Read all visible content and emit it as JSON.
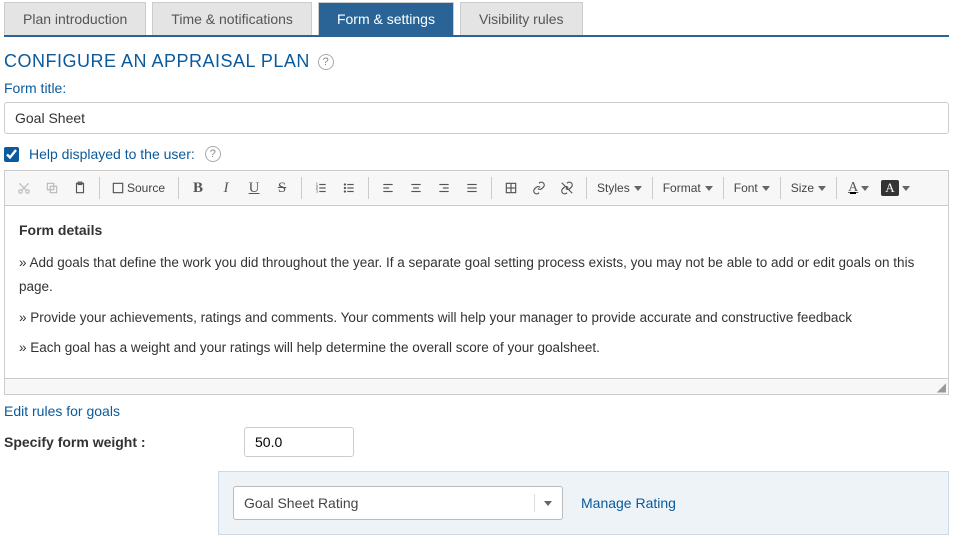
{
  "tabs": [
    {
      "label": "Plan introduction",
      "active": false
    },
    {
      "label": "Time & notifications",
      "active": false
    },
    {
      "label": "Form & settings",
      "active": true
    },
    {
      "label": "Visibility rules",
      "active": false
    }
  ],
  "page_title": "CONFIGURE AN APPRAISAL PLAN",
  "form_title_label": "Form title:",
  "form_title_value": "Goal Sheet",
  "help_checkbox_label": "Help displayed to the user:",
  "help_checked": true,
  "toolbar": {
    "source_label": "Source",
    "styles": "Styles",
    "format": "Format",
    "font": "Font",
    "size": "Size"
  },
  "editor": {
    "heading": "Form details",
    "bullets": [
      "Add goals that define the work you did throughout the year. If a separate goal setting process exists, you may not be able to add or edit goals on this page.",
      "Provide your achievements, ratings and comments. Your comments will help your manager to provide accurate and constructive feedback",
      "Each goal has a weight and your ratings will help determine the overall score of your goalsheet."
    ]
  },
  "edit_rules_link": "Edit rules for goals",
  "weight_label": "Specify form weight :",
  "weight_value": "50.0",
  "rating_select_value": "Goal Sheet Rating",
  "manage_rating_link": "Manage Rating"
}
